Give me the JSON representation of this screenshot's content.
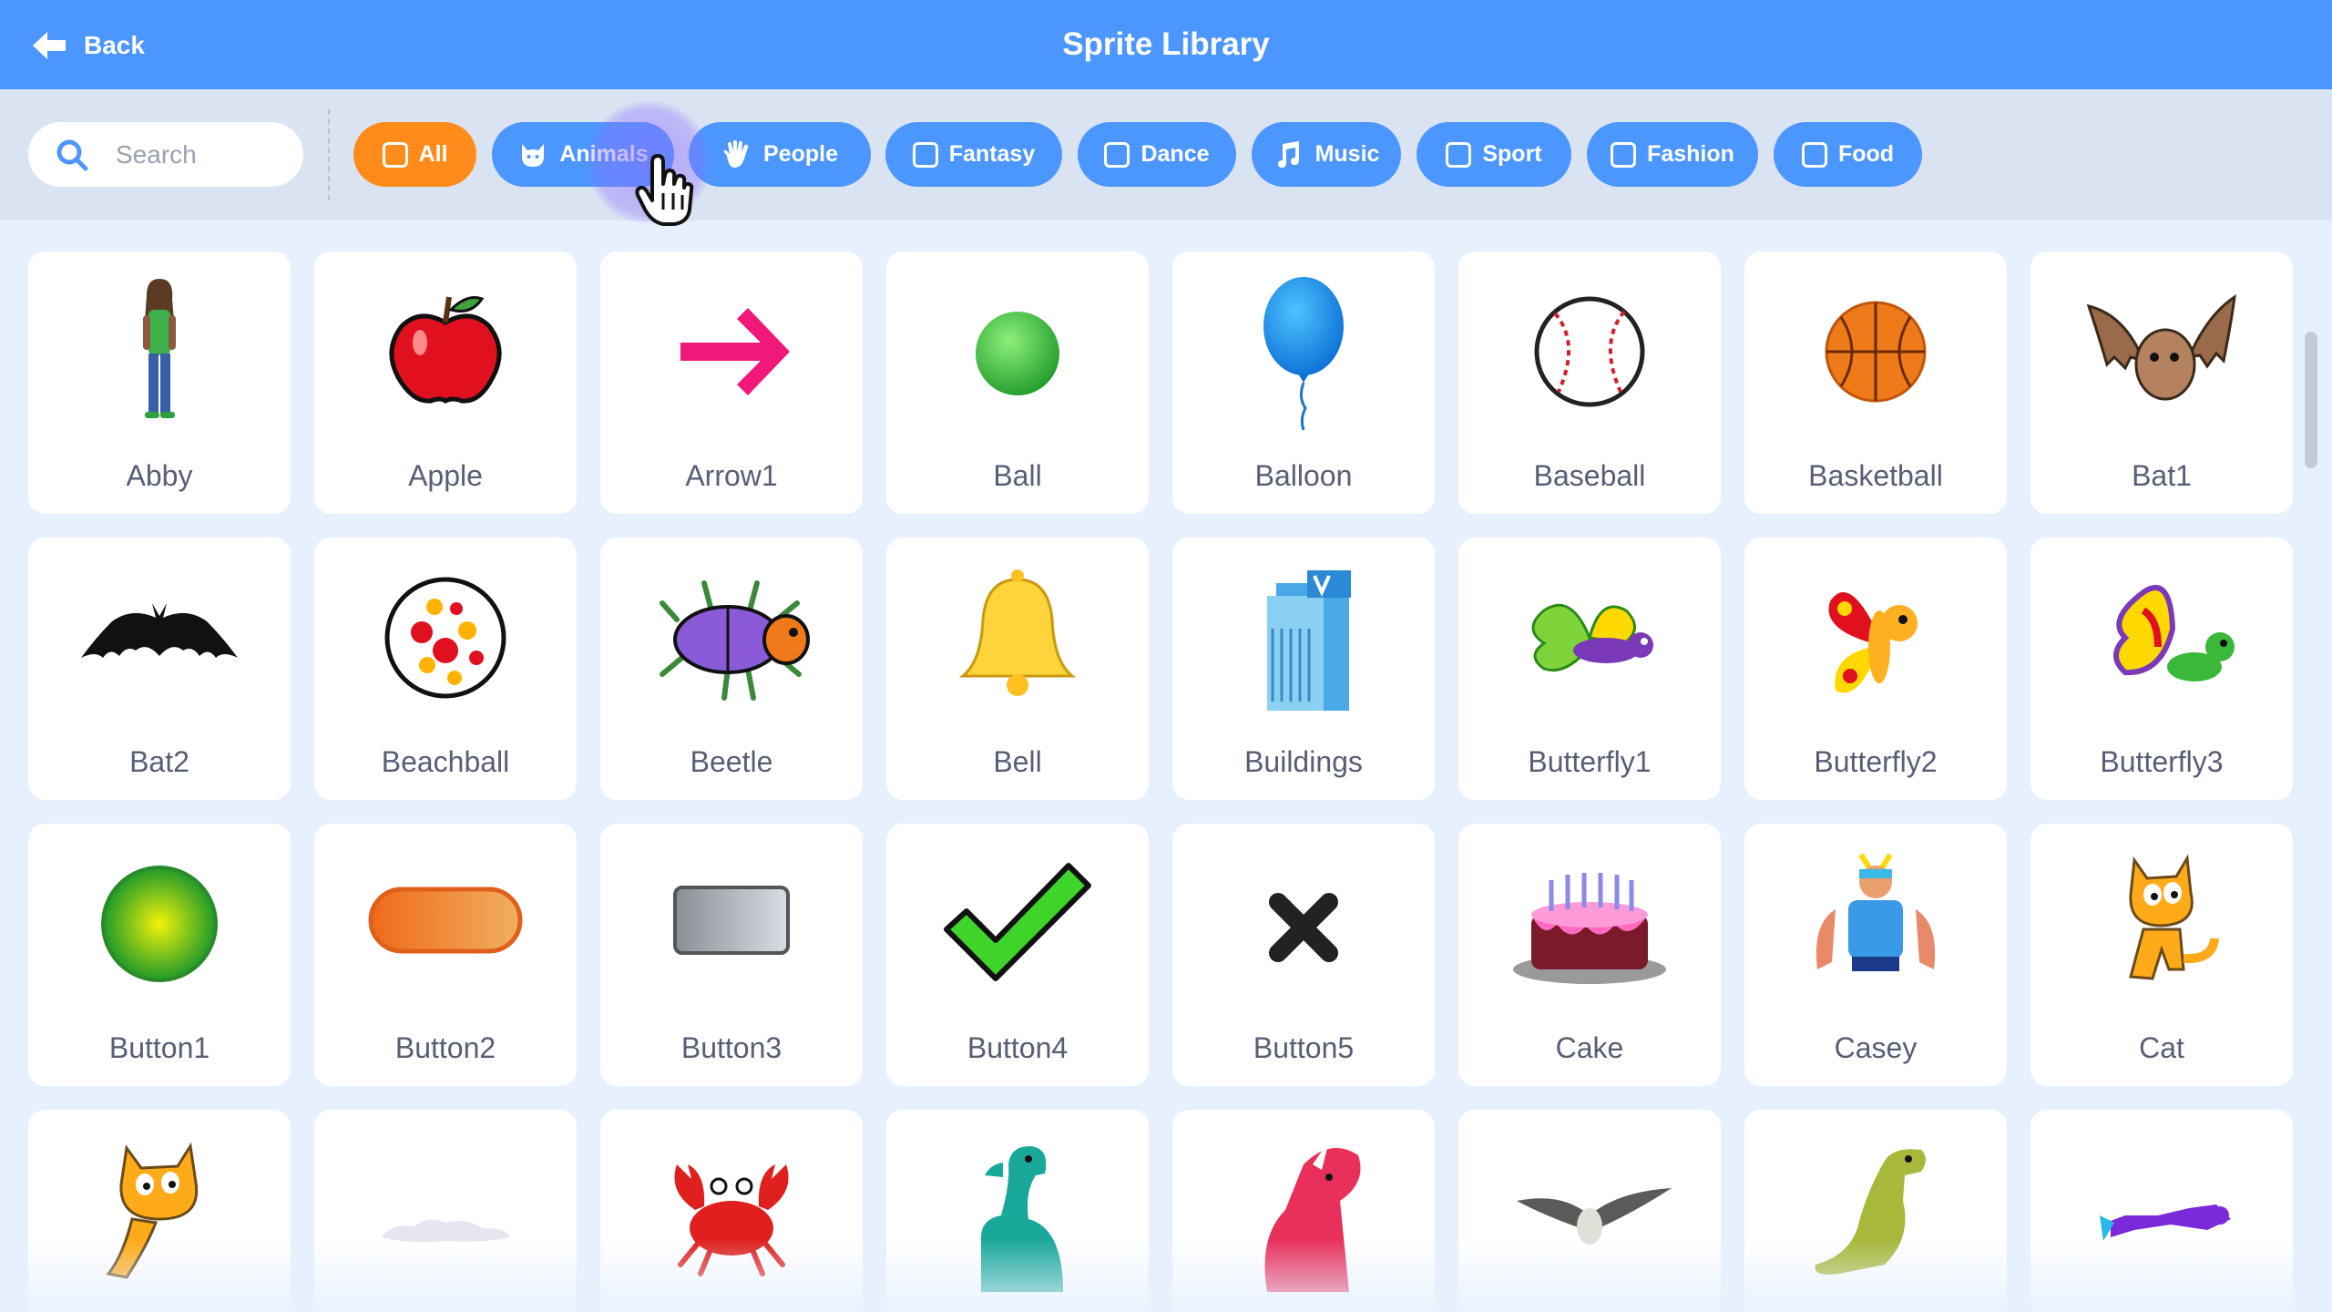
{
  "header": {
    "back_label": "Back",
    "title": "Sprite Library"
  },
  "search": {
    "placeholder": "Search",
    "value": ""
  },
  "tags": [
    {
      "label": "All",
      "active": true
    },
    {
      "label": "Animals"
    },
    {
      "label": "People"
    },
    {
      "label": "Fantasy"
    },
    {
      "label": "Dance"
    },
    {
      "label": "Music"
    },
    {
      "label": "Sport"
    },
    {
      "label": "Fashion"
    },
    {
      "label": "Food"
    }
  ],
  "colors": {
    "header": "#4c97ff",
    "active_tag": "#ff8c1a",
    "background": "#e6f0ff",
    "text": "#575e75"
  },
  "sprites": [
    {
      "name": "Abby",
      "icon": "abby-icon"
    },
    {
      "name": "Apple",
      "icon": "apple-icon"
    },
    {
      "name": "Arrow1",
      "icon": "arrow-icon"
    },
    {
      "name": "Ball",
      "icon": "ball-icon"
    },
    {
      "name": "Balloon",
      "icon": "balloon-icon"
    },
    {
      "name": "Baseball",
      "icon": "baseball-icon"
    },
    {
      "name": "Basketball",
      "icon": "basketball-icon"
    },
    {
      "name": "Bat1",
      "icon": "bat1-icon"
    },
    {
      "name": "Bat2",
      "icon": "bat2-icon"
    },
    {
      "name": "Beachball",
      "icon": "beachball-icon"
    },
    {
      "name": "Beetle",
      "icon": "beetle-icon"
    },
    {
      "name": "Bell",
      "icon": "bell-icon"
    },
    {
      "name": "Buildings",
      "icon": "buildings-icon"
    },
    {
      "name": "Butterfly1",
      "icon": "butterfly1-icon"
    },
    {
      "name": "Butterfly2",
      "icon": "butterfly2-icon"
    },
    {
      "name": "Butterfly3",
      "icon": "butterfly3-icon"
    },
    {
      "name": "Button1",
      "icon": "button1-icon"
    },
    {
      "name": "Button2",
      "icon": "button2-icon"
    },
    {
      "name": "Button3",
      "icon": "button3-icon"
    },
    {
      "name": "Button4",
      "icon": "checkmark-icon"
    },
    {
      "name": "Button5",
      "icon": "x-icon"
    },
    {
      "name": "Cake",
      "icon": "cake-icon"
    },
    {
      "name": "Casey",
      "icon": "casey-icon"
    },
    {
      "name": "Cat",
      "icon": "cat-icon"
    },
    {
      "name": "",
      "icon": "flying-cat-icon"
    },
    {
      "name": "",
      "icon": "cloud-icon"
    },
    {
      "name": "",
      "icon": "crab-icon"
    },
    {
      "name": "",
      "icon": "dinosaur-icon"
    },
    {
      "name": "",
      "icon": "triceratops-icon"
    },
    {
      "name": "",
      "icon": "pterodactyl-icon"
    },
    {
      "name": "",
      "icon": "trex-icon"
    },
    {
      "name": "",
      "icon": "diver-icon"
    }
  ]
}
